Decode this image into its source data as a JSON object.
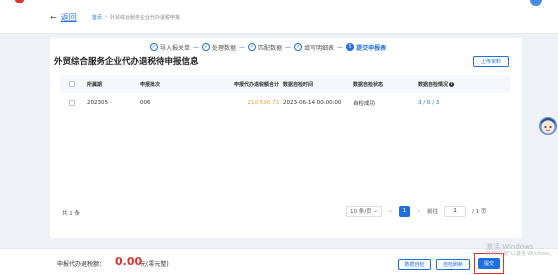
{
  "header": {
    "back_label": "返回",
    "breadcrumb": [
      "首页",
      "外贸综合服务企业代办退税申报"
    ]
  },
  "steps": [
    {
      "label": "导入报关单",
      "state": "done",
      "mark": "✓"
    },
    {
      "label": "处理数据",
      "state": "done",
      "mark": "✓"
    },
    {
      "label": "匹配数据",
      "state": "done",
      "mark": "✓"
    },
    {
      "label": "填写明细表",
      "state": "done",
      "mark": "✓"
    },
    {
      "label": "提交申报表",
      "state": "active",
      "mark": "5"
    }
  ],
  "page": {
    "title": "外贸综合服务企业代办退税待申报信息",
    "upload_button": "上传资料"
  },
  "table": {
    "headers": {
      "period": "所属期",
      "batch": "申报批次",
      "total": "申报代办退税额合计",
      "time": "数据自检时间",
      "status": "数据自检状态",
      "result": "数据自检情况"
    },
    "rows": [
      {
        "period": "202305",
        "batch": "006",
        "total": "210,536.71",
        "time": "2023-06-14 00:00:00",
        "status": "自检成功",
        "result": "3 / 0 / 3"
      }
    ]
  },
  "pagination": {
    "total_text": "共 1 条",
    "page_size": "10 条/页",
    "prev": "<",
    "current_page": "1",
    "next": ">",
    "goto_label": "前往",
    "goto_value": "1",
    "total_pages": "/ 1 页"
  },
  "footer": {
    "sum_label": "申报代办退税额：",
    "sum_amount": "0.00",
    "sum_unit": "元(零元整)",
    "export_button": "数据自检",
    "refresh_button": "自检刷新",
    "submit_button": "提交"
  },
  "watermark": {
    "line1": "激活 Windows",
    "line2": "转到\"设置\"以激活 Windows。"
  },
  "colors": {
    "primary": "#1f6fe0",
    "danger": "#e0302b",
    "warning": "#e6a23c"
  }
}
